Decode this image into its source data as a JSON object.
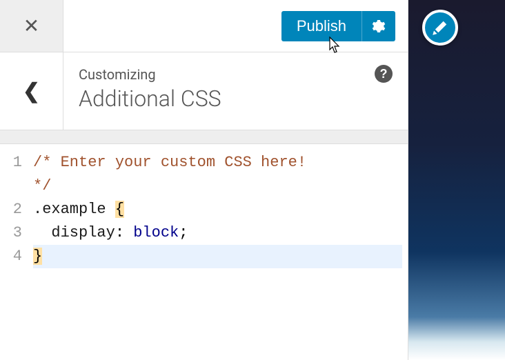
{
  "header": {
    "publish_label": "Publish"
  },
  "section": {
    "customizing_label": "Customizing",
    "title": "Additional CSS",
    "help_label": "?"
  },
  "editor": {
    "line_numbers": [
      "1",
      "",
      "2",
      "3",
      "4"
    ],
    "lines": {
      "l1a": "/* Enter your custom CSS here!",
      "l1b": "*/",
      "l2_selector": ".example ",
      "l2_brace": "{",
      "l3_indent": "  ",
      "l3_prop": "display",
      "l3_colon": ": ",
      "l3_val": "block",
      "l3_semi": ";",
      "l4_brace": "}"
    }
  }
}
